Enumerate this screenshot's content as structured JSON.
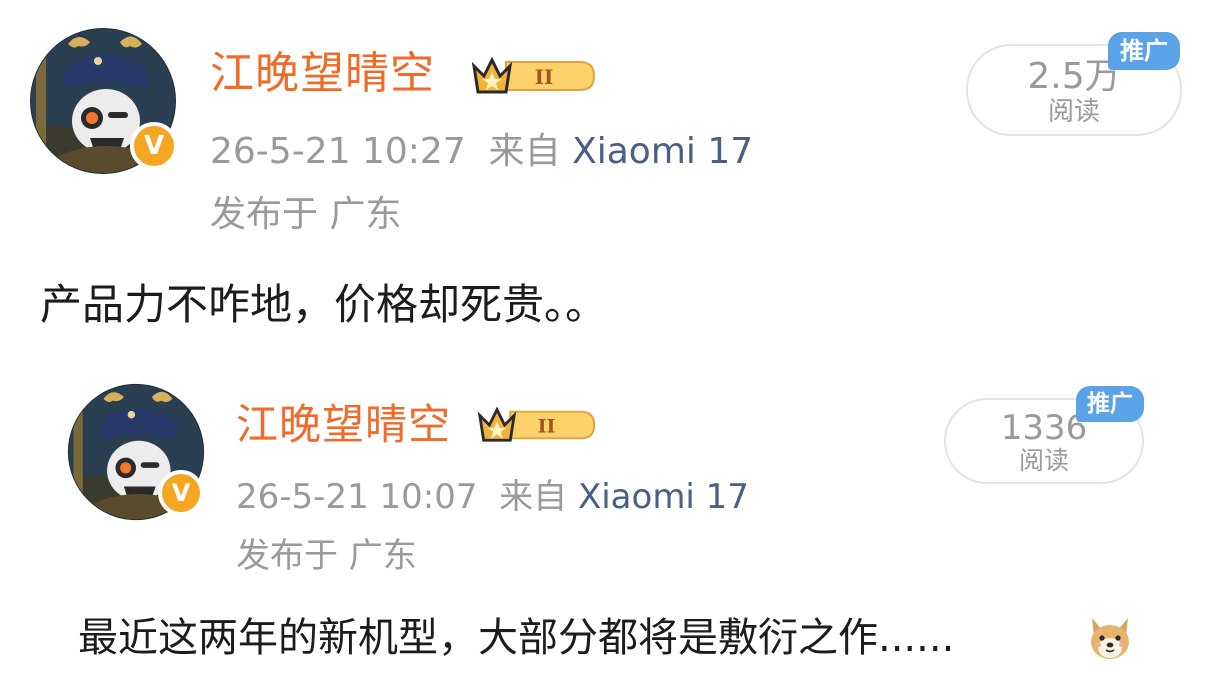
{
  "posts": [
    {
      "username": "江晚望晴空",
      "level_label": "II",
      "timestamp": "26-5-21 10:27",
      "source_prefix": "来自",
      "device": "Xiaomi 17",
      "location": "发布于 广东",
      "read_count": "2.5万",
      "read_label": "阅读",
      "promo_label": "推广",
      "content": "产品力不咋地，价格却死贵。。",
      "verified_icon": "v-badge-icon"
    },
    {
      "username": "江晚望晴空",
      "level_label": "II",
      "timestamp": "26-5-21 10:07",
      "source_prefix": "来自",
      "device": "Xiaomi 17",
      "location": "发布于 广东",
      "read_count": "1336",
      "read_label": "阅读",
      "promo_label": "推广",
      "content": "最近这两年的新机型，大部分都将是敷衍之作......",
      "emoji": "dog-face-icon",
      "verified_icon": "v-badge-icon"
    }
  ],
  "colors": {
    "username": "#f06a28",
    "meta": "#9a9a9a",
    "device": "#4a5f86",
    "promo": "#5aa3e6",
    "badge_gold": "#f5a623"
  }
}
